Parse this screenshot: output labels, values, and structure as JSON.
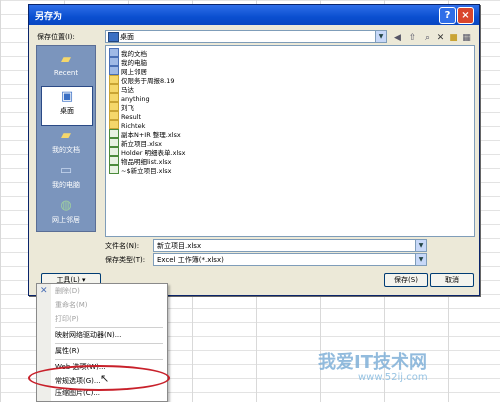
{
  "dialog": {
    "title": "另存为",
    "save_in_label": "保存位置(I):",
    "save_in_value": "桌面",
    "toolbar_icons": [
      "back-icon",
      "up-folder-icon",
      "search-icon",
      "delete-icon",
      "new-folder-icon",
      "views-icon"
    ],
    "places": [
      {
        "label": "Recent"
      },
      {
        "label": "桌面"
      },
      {
        "label": "我的文档"
      },
      {
        "label": "我的电脑"
      },
      {
        "label": "网上邻居"
      }
    ],
    "files": [
      {
        "name": "我的文档",
        "icon": "sys"
      },
      {
        "name": "我的电脑",
        "icon": "sys"
      },
      {
        "name": "网上邻居",
        "icon": "sys"
      },
      {
        "name": "仅限务于周报8.19",
        "icon": "folder"
      },
      {
        "name": "马达",
        "icon": "folder"
      },
      {
        "name": "anything",
        "icon": "folder"
      },
      {
        "name": "刘飞",
        "icon": "folder"
      },
      {
        "name": "Result",
        "icon": "folder"
      },
      {
        "name": "Richtek",
        "icon": "folder"
      },
      {
        "name": "副本N+IR 整理.xlsx",
        "icon": "xls"
      },
      {
        "name": "新立项目.xlsx",
        "icon": "xls"
      },
      {
        "name": "Holder 明细表单.xlsx",
        "icon": "xls"
      },
      {
        "name": "物品明细list.xlsx",
        "icon": "xls"
      },
      {
        "name": "~$新立项目.xlsx",
        "icon": "xls"
      }
    ],
    "filename_label": "文件名(N):",
    "filename_value": "新立项目.xlsx",
    "filetype_label": "保存类型(T):",
    "filetype_value": "Excel 工作簿(*.xlsx)",
    "tools_label": "工具(L)",
    "save_label": "保存(S)",
    "cancel_label": "取消"
  },
  "tools_menu": {
    "items": [
      {
        "label": "删除(D)",
        "disabled": true
      },
      {
        "label": "重命名(M)",
        "disabled": true
      },
      {
        "label": "打印(P)",
        "disabled": true
      },
      {
        "label": "映射网络驱动器(N)...",
        "disabled": false
      },
      {
        "label": "属性(R)",
        "disabled": false
      },
      {
        "label": "Web 选项(W)...",
        "disabled": false
      },
      {
        "label": "常规选项(G)...",
        "disabled": false
      },
      {
        "label": "压缩图片(C)...",
        "disabled": false
      }
    ]
  },
  "watermark": {
    "main": "我爱IT技术网",
    "url": "www.52ij.com"
  }
}
